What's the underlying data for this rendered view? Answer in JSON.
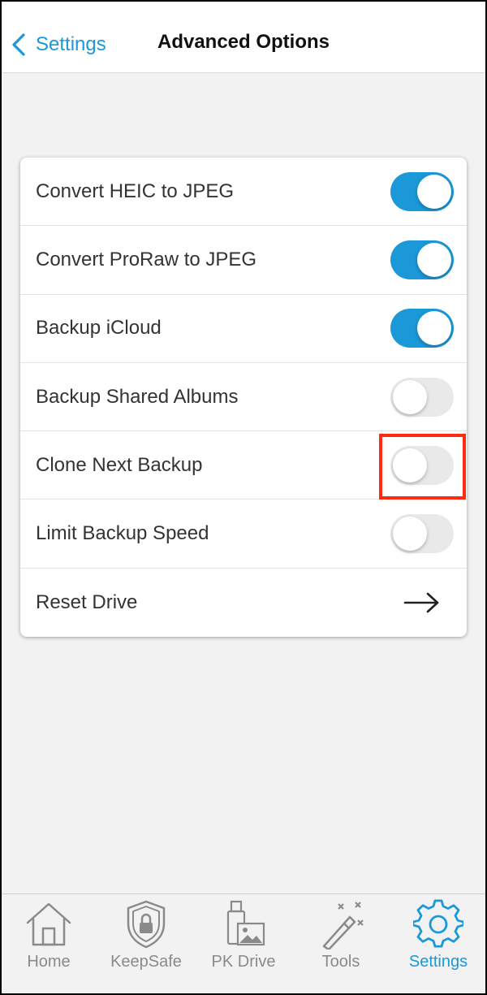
{
  "nav": {
    "back_label": "Settings",
    "title": "Advanced Options"
  },
  "options": [
    {
      "label": "Convert HEIC to JPEG",
      "enabled": true
    },
    {
      "label": "Convert ProRaw to JPEG",
      "enabled": true
    },
    {
      "label": "Backup iCloud",
      "enabled": true
    },
    {
      "label": "Backup Shared Albums",
      "enabled": false
    },
    {
      "label": "Clone Next Backup",
      "enabled": false
    },
    {
      "label": "Limit Backup Speed",
      "enabled": false
    }
  ],
  "reset": {
    "label": "Reset Drive",
    "icon": "arrow-right-icon"
  },
  "tabs": [
    {
      "label": "Home",
      "icon": "home-icon"
    },
    {
      "label": "KeepSafe",
      "icon": "shield-lock-icon"
    },
    {
      "label": "PK Drive",
      "icon": "drive-photo-icon"
    },
    {
      "label": "Tools",
      "icon": "magic-wand-icon"
    },
    {
      "label": "Settings",
      "icon": "gear-icon",
      "active": true
    }
  ],
  "colors": {
    "accent": "#1a98d8",
    "highlight": "#ff2a12",
    "inactive": "#8a8a8a"
  }
}
